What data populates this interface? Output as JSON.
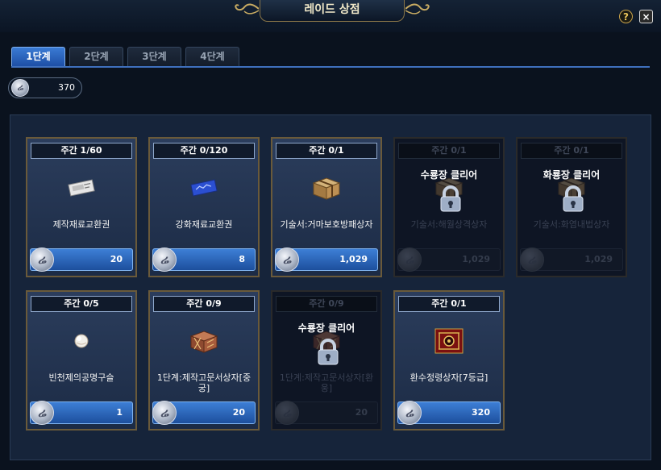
{
  "window": {
    "title": "레이드 상점"
  },
  "header": {
    "help_label": "?",
    "close_label": "×"
  },
  "tabs": [
    {
      "label": "1단계",
      "active": true
    },
    {
      "label": "2단계",
      "active": false
    },
    {
      "label": "3단계",
      "active": false
    },
    {
      "label": "4단계",
      "active": false
    }
  ],
  "currency": {
    "coin_glyph": "ሬ",
    "amount": "370"
  },
  "items": [
    {
      "limit": "주간 1/60",
      "name": "제작재료교환권",
      "price": "20",
      "locked": false,
      "icon": "ticket-icon"
    },
    {
      "limit": "주간 0/120",
      "name": "강화재료교환권",
      "price": "8",
      "locked": false,
      "icon": "blue-ticket-icon"
    },
    {
      "limit": "주간 0/1",
      "name": "기술서:거마보호방패상자",
      "price": "1,029",
      "locked": false,
      "icon": "box-icon"
    },
    {
      "limit": "주간 0/1",
      "name": "기술서:해월상격상자",
      "price": "1,029",
      "locked": true,
      "lock_text": "수룡장 클리어",
      "icon": "box-icon"
    },
    {
      "limit": "주간 0/1",
      "name": "기술서:화염내법상자",
      "price": "1,029",
      "locked": true,
      "lock_text": "화룡장 클리어",
      "icon": "box-icon"
    },
    {
      "limit": "주간 0/5",
      "name": "빈천제의공명구슬",
      "price": "1",
      "locked": false,
      "icon": "orb-icon"
    },
    {
      "limit": "주간 0/9",
      "name": "1단계:제작고문서상자[중궁]",
      "price": "20",
      "locked": false,
      "icon": "crate-icon"
    },
    {
      "limit": "주간 0/9",
      "name": "1단계:제작고문서상자[환웅]",
      "price": "20",
      "locked": true,
      "lock_text": "수룡장 클리어",
      "icon": "crate-icon"
    },
    {
      "limit": "주간 0/1",
      "name": "환수정령상자[7등급]",
      "price": "320",
      "locked": false,
      "icon": "spirit-box-icon"
    }
  ]
}
